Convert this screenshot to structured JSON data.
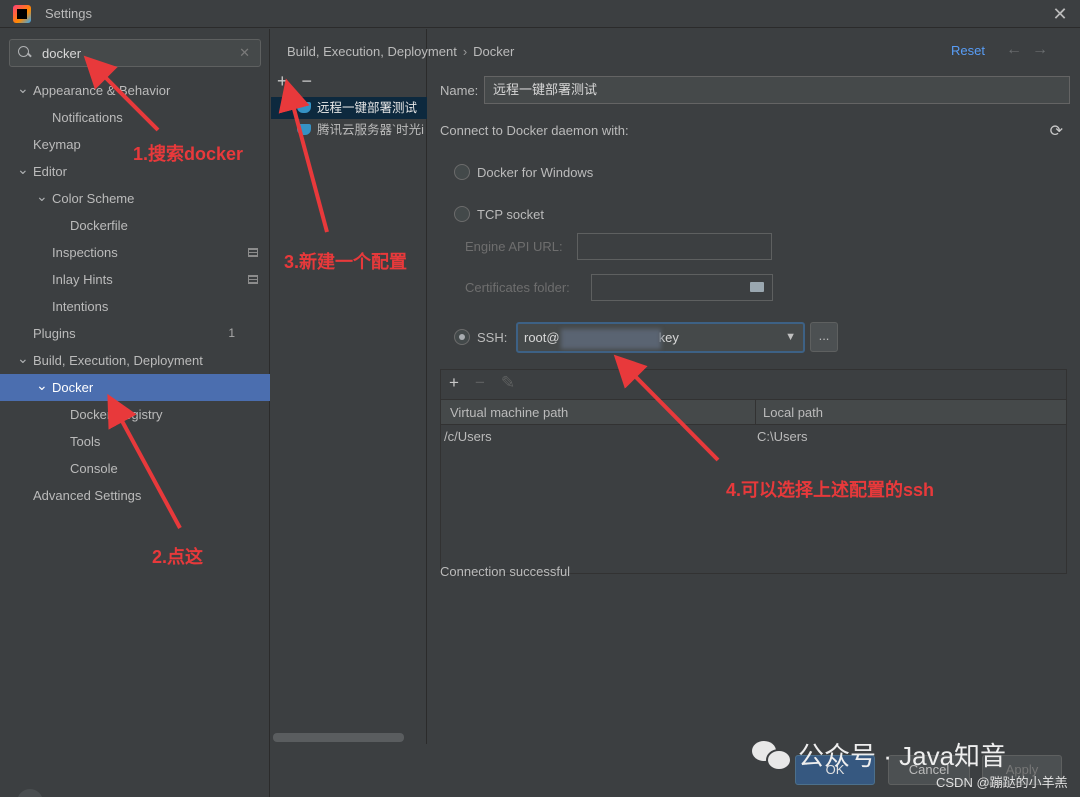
{
  "window": {
    "title": "Settings"
  },
  "search": {
    "value": "docker"
  },
  "tree": [
    {
      "label": "Appearance & Behavior",
      "level": 0,
      "expanded": true
    },
    {
      "label": "Notifications",
      "level": 1
    },
    {
      "label": "Keymap",
      "level": 0
    },
    {
      "label": "Editor",
      "level": 0,
      "expanded": true
    },
    {
      "label": "Color Scheme",
      "level": 1,
      "expanded": true
    },
    {
      "label": "Dockerfile",
      "level": 2
    },
    {
      "label": "Inspections",
      "level": 1
    },
    {
      "label": "Inlay Hints",
      "level": 1
    },
    {
      "label": "Intentions",
      "level": 1
    },
    {
      "label": "Plugins",
      "level": 0,
      "badge": "1"
    },
    {
      "label": "Build, Execution, Deployment",
      "level": 0,
      "expanded": true
    },
    {
      "label": "Docker",
      "level": 1,
      "expanded": true,
      "selected": true
    },
    {
      "label": "Docker Registry",
      "level": 2
    },
    {
      "label": "Tools",
      "level": 2
    },
    {
      "label": "Console",
      "level": 2
    },
    {
      "label": "Advanced Settings",
      "level": 0
    }
  ],
  "configs": [
    {
      "label": "远程一键部署测试",
      "selected": true
    },
    {
      "label": "腾讯云服务器`时光i"
    }
  ],
  "breadcrumb": {
    "parent": "Build, Execution, Deployment",
    "sep": "›",
    "current": "Docker"
  },
  "header": {
    "reset": "Reset"
  },
  "form": {
    "name_label": "Name:",
    "name_value": "远程一键部署测试",
    "connect_label": "Connect to Docker daemon with:",
    "opt_windows": "Docker for Windows",
    "opt_tcp": "TCP socket",
    "engine_api_label": "Engine API URL:",
    "cert_label": "Certificates folder:",
    "opt_ssh": "SSH:",
    "ssh_prefix": "root@",
    "ssh_suffix": "key",
    "dots": "..."
  },
  "mappings": {
    "headers": [
      "Virtual machine path",
      "Local path"
    ],
    "rows": [
      [
        "/c/Users",
        "C:\\Users"
      ]
    ]
  },
  "status": "Connection successful",
  "buttons": {
    "ok": "OK",
    "cancel": "Cancel",
    "apply": "Apply"
  },
  "annotations": {
    "a1": "1.搜索docker",
    "a2": "2.点这",
    "a3": "3.新建一个配置",
    "a4": "4.可以选择上述配置的ssh"
  },
  "watermark": {
    "main": "公众号 · Java知音",
    "csdn": "CSDN @蹦跶的小羊羔"
  },
  "colors": {
    "selection": "#4b6eaf",
    "accent_link": "#589df6",
    "annotation": "#e8393b"
  }
}
